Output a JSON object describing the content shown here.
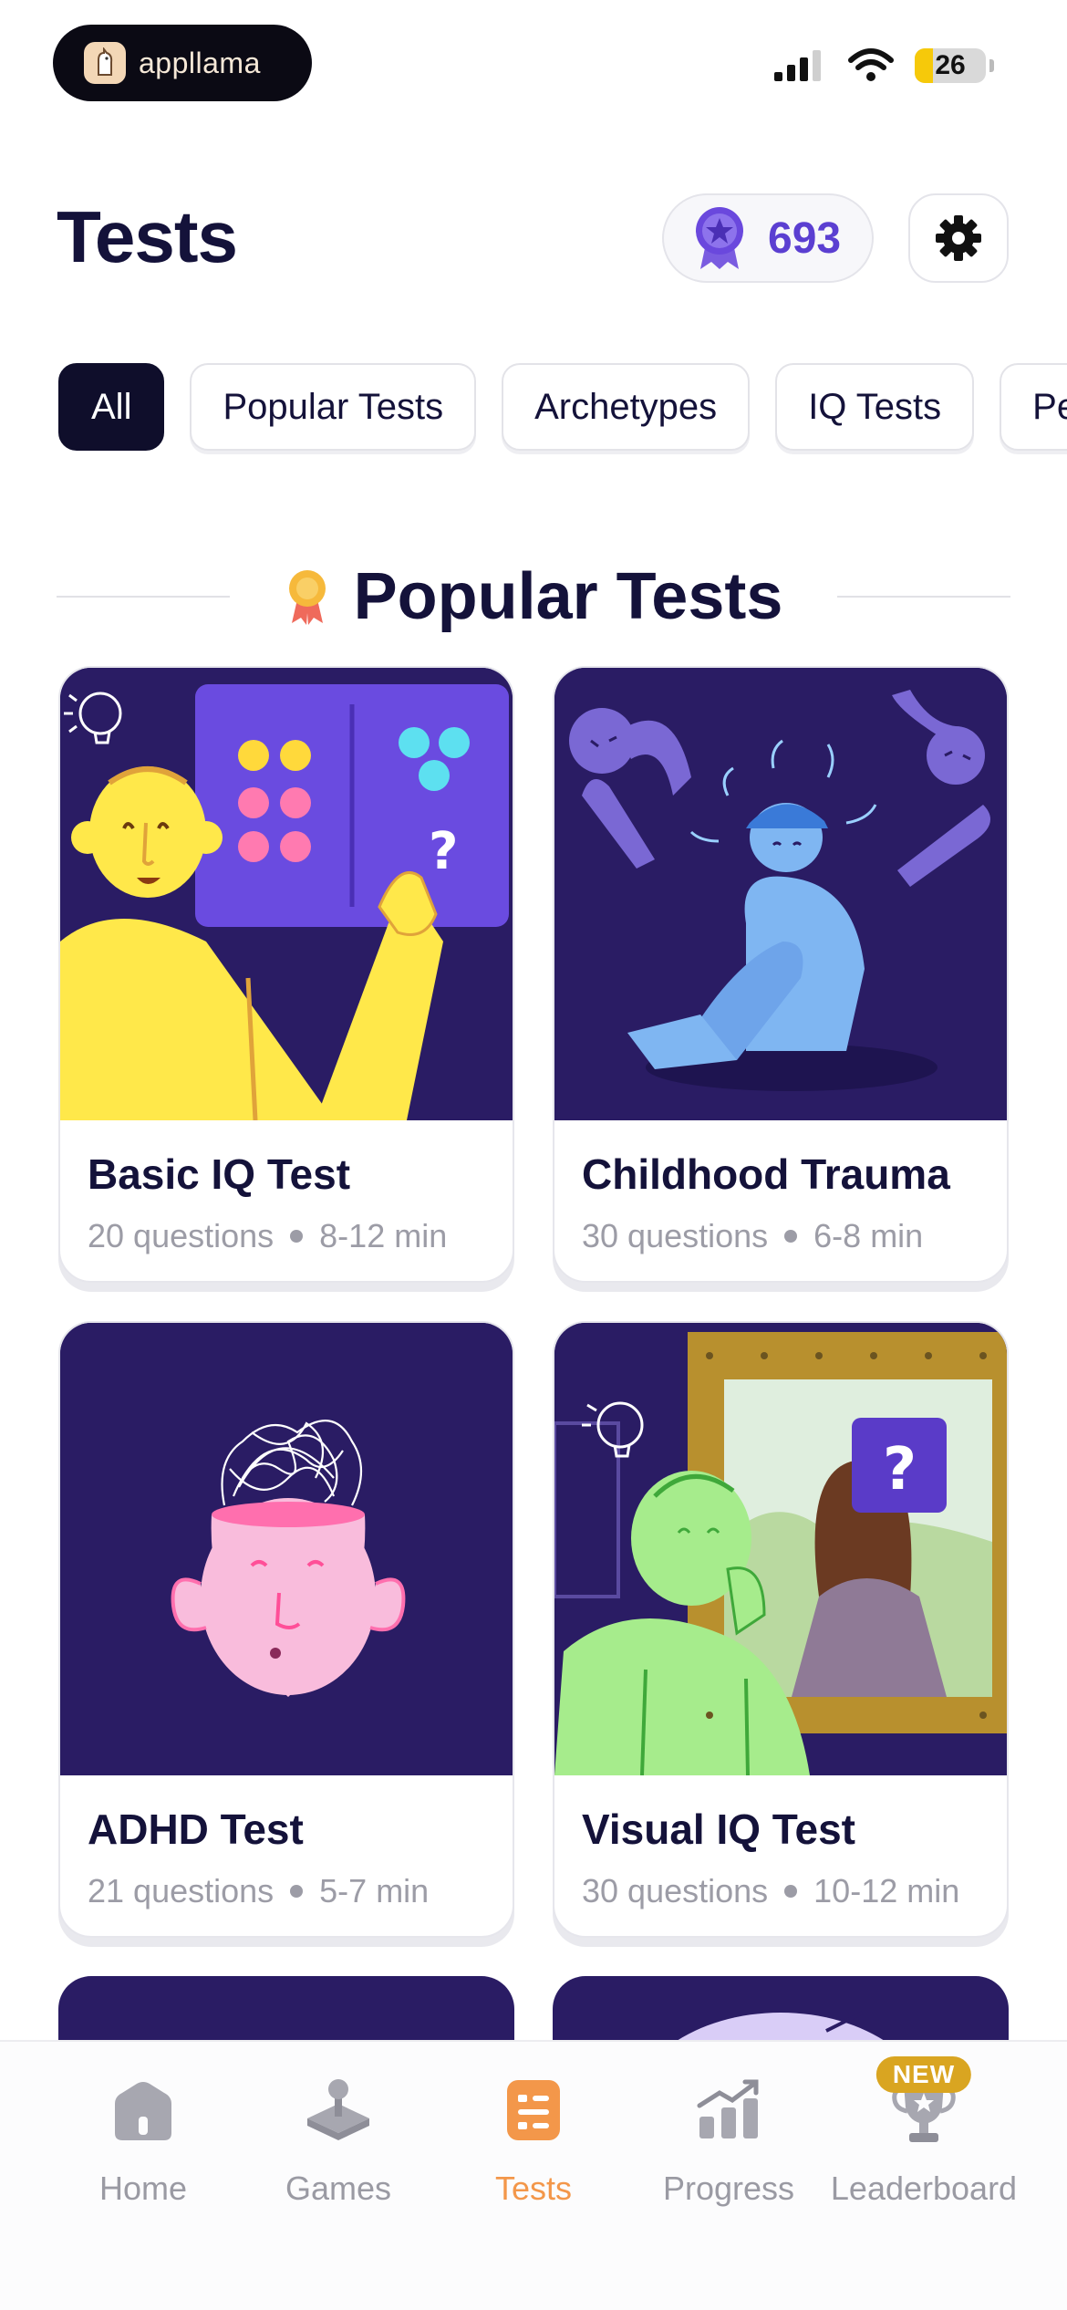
{
  "status_bar": {
    "app_pill_label": "appllama",
    "battery": "26"
  },
  "header": {
    "title": "Tests",
    "gems_count": "693"
  },
  "filters": [
    {
      "label": "All",
      "active": true
    },
    {
      "label": "Popular Tests"
    },
    {
      "label": "Archetypes"
    },
    {
      "label": "IQ Tests"
    },
    {
      "label": "Pe"
    }
  ],
  "section": {
    "title": "Popular Tests"
  },
  "tests": [
    {
      "title": "Basic IQ Test",
      "questions": "20 questions",
      "duration": "8-12 min"
    },
    {
      "title": "Childhood Trauma",
      "questions": "30 questions",
      "duration": "6-8 min"
    },
    {
      "title": "ADHD Test",
      "questions": "21 questions",
      "duration": "5-7 min"
    },
    {
      "title": "Visual IQ Test",
      "questions": "30 questions",
      "duration": "10-12 min"
    }
  ],
  "tabbar": {
    "home": "Home",
    "games": "Games",
    "tests": "Tests",
    "progress": "Progress",
    "leaderboard": "Leaderboard",
    "new_badge": "NEW"
  },
  "colors": {
    "accent": "#f3974a",
    "dark": "#0f0e2b",
    "card_art_bg": "#2a1c64",
    "gem": "#5b3fd1"
  }
}
